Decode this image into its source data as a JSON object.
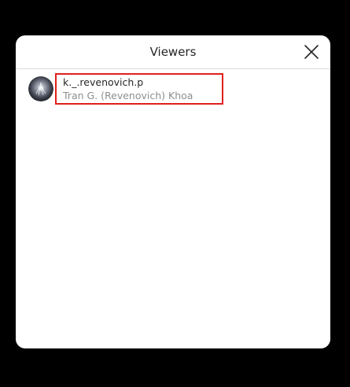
{
  "modal": {
    "title": "Viewers",
    "close_icon": "close-x-icon"
  },
  "viewers": [
    {
      "username": "k._.revenovich.p",
      "full_name": "Tran G. (Revenovich) Khoa",
      "avatar_icon": "avatar-image"
    }
  ],
  "colors": {
    "background": "#000000",
    "modal": "#ffffff",
    "primary_text": "#262626",
    "secondary_text": "#8e8e8e",
    "divider": "#dbdbdb",
    "highlight": "#e0201c"
  }
}
